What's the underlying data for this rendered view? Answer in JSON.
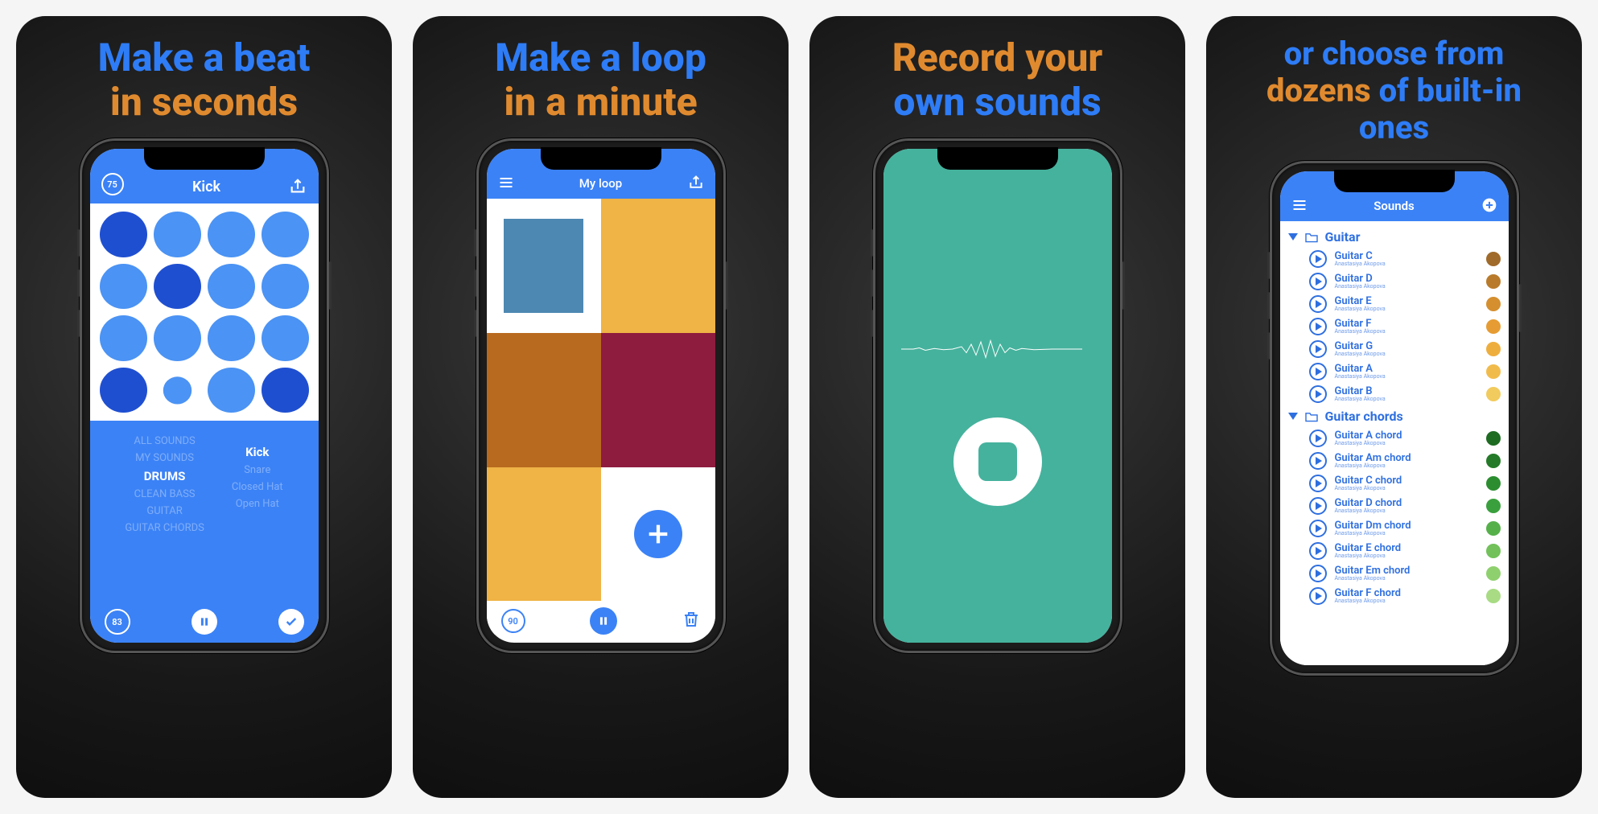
{
  "colors": {
    "accent_blue": "#2e7cf6",
    "accent_orange": "#e08a2f",
    "app_blue": "#3b82f6",
    "teal": "#45b29d"
  },
  "panel1": {
    "headline_blue": "Make a beat",
    "headline_orange": "in seconds",
    "bpm_top": "75",
    "title": "Kick",
    "pads": [
      "#1f4fd1",
      "#4b93f4",
      "#4b93f4",
      "#4b93f4",
      "#4b93f4",
      "#1f4fd1",
      "#4b93f4",
      "#4b93f4",
      "#4b93f4",
      "#4b93f4",
      "#4b93f4",
      "#4b93f4",
      "#1f4fd1",
      "#4b93f4",
      "#4b93f4",
      "#1f4fd1"
    ],
    "pad_scales": [
      1,
      1,
      1,
      1,
      1,
      1,
      1,
      1,
      1,
      1,
      1,
      1,
      1,
      0.6,
      1,
      1
    ],
    "picker_left": [
      "ALL SOUNDS",
      "MY SOUNDS",
      "DRUMS",
      "CLEAN BASS",
      "GUITAR",
      "GUITAR CHORDS"
    ],
    "picker_left_selected_index": 2,
    "picker_right": [
      "",
      "",
      "Kick",
      "Snare",
      "Closed Hat",
      "Open Hat"
    ],
    "picker_right_selected_index": 2,
    "bpm_bottom": "83"
  },
  "panel2": {
    "headline_blue": "Make a loop",
    "headline_orange": "in a minute",
    "title": "My loop",
    "tiles": [
      {
        "type": "inner-square",
        "bg": "#ffffff"
      },
      {
        "type": "solid",
        "bg": "#efb346"
      },
      {
        "type": "solid",
        "bg": "#b86a1f"
      },
      {
        "type": "solid",
        "bg": "#8e1c3f"
      },
      {
        "type": "solid",
        "bg": "#efb346"
      },
      {
        "type": "add",
        "bg": "#ffffff"
      }
    ],
    "bpm": "90"
  },
  "panel3": {
    "headline_orange": "Record your",
    "headline_blue": "own sounds"
  },
  "panel4": {
    "headline_blue_line1": "or choose from",
    "headline_orange": "dozens ",
    "headline_blue_line2_tail": "of built-in",
    "headline_blue_line3": "ones",
    "title": "Sounds",
    "author": "Anastasiya Akopova",
    "folders": [
      {
        "name": "Guitar",
        "items": [
          {
            "name": "Guitar C",
            "swatch": "#a06a2a"
          },
          {
            "name": "Guitar D",
            "swatch": "#b97b2b"
          },
          {
            "name": "Guitar E",
            "swatch": "#d58f2f"
          },
          {
            "name": "Guitar F",
            "swatch": "#e69c33"
          },
          {
            "name": "Guitar G",
            "swatch": "#eeae3e"
          },
          {
            "name": "Guitar A",
            "swatch": "#f1bb4c"
          },
          {
            "name": "Guitar B",
            "swatch": "#f2cb5e"
          }
        ]
      },
      {
        "name": "Guitar chords",
        "items": [
          {
            "name": "Guitar A chord",
            "swatch": "#1e6b22"
          },
          {
            "name": "Guitar Am chord",
            "swatch": "#247a28"
          },
          {
            "name": "Guitar C chord",
            "swatch": "#2c8d30"
          },
          {
            "name": "Guitar D chord",
            "swatch": "#3aa03d"
          },
          {
            "name": "Guitar Dm chord",
            "swatch": "#55b04a"
          },
          {
            "name": "Guitar E chord",
            "swatch": "#72c15a"
          },
          {
            "name": "Guitar Em chord",
            "swatch": "#8fd06e"
          },
          {
            "name": "Guitar F chord",
            "swatch": "#a8db84"
          }
        ]
      }
    ]
  }
}
